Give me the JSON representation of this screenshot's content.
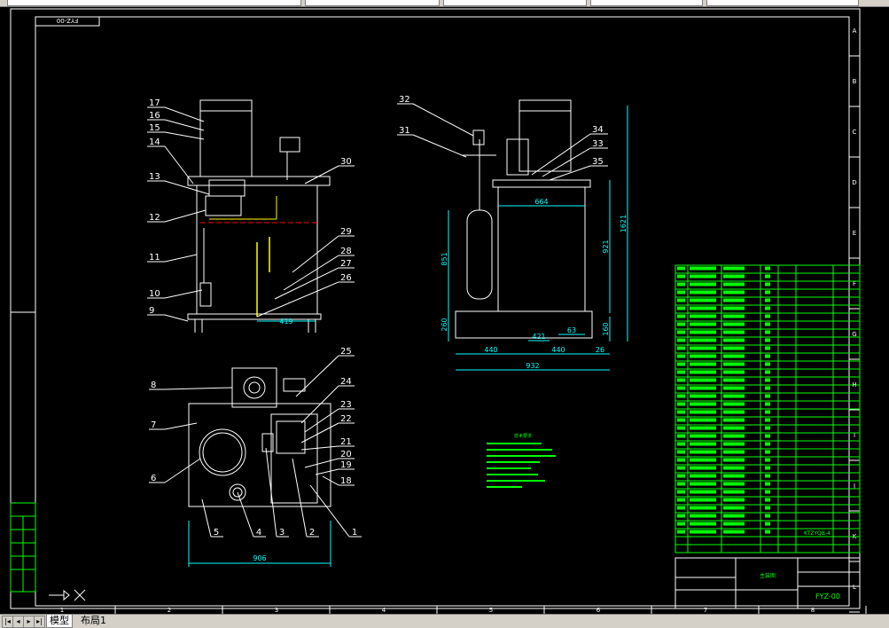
{
  "toolbar": {
    "fields": [
      "",
      "",
      "",
      "",
      ""
    ]
  },
  "drawing": {
    "title_box": "FYZ-00",
    "row_letters": [
      "A",
      "B",
      "C",
      "D",
      "E",
      "F",
      "G",
      "H",
      "I",
      "J",
      "K",
      "L"
    ],
    "col_numbers": [
      "1",
      "2",
      "3",
      "4",
      "5",
      "6",
      "7",
      "8"
    ],
    "front_callouts": [
      "17",
      "16",
      "15",
      "14",
      "13",
      "12",
      "11",
      "10",
      "9"
    ],
    "front_right_callouts": [
      "30",
      "29",
      "28",
      "27",
      "26"
    ],
    "front_dim": "419",
    "plan_left_callouts": [
      "8",
      "7",
      "6"
    ],
    "plan_bottom_callouts": [
      "5",
      "4",
      "3",
      "2",
      "1"
    ],
    "plan_right_callouts": [
      "25",
      "24",
      "23",
      "22",
      "21",
      "20",
      "19",
      "18"
    ],
    "plan_dim": "906",
    "side_callouts_left": [
      "32",
      "31"
    ],
    "side_callouts_right": [
      "34",
      "33",
      "35"
    ],
    "side_dims": {
      "top_width": "664",
      "height_total": "1621",
      "height_body": "921",
      "height_accum": "851",
      "height_base": "260",
      "right_base": "160",
      "offset": "63",
      "center": "421",
      "half_left": "440",
      "half_right": "440",
      "tail": "26",
      "total_width": "932"
    },
    "bom_title_col": "",
    "title_block": {
      "drawing_no": "FYZ-00",
      "code": "KTZYQB-4"
    }
  },
  "layout_tabs": {
    "model": "模型",
    "layout1": "布局1"
  }
}
